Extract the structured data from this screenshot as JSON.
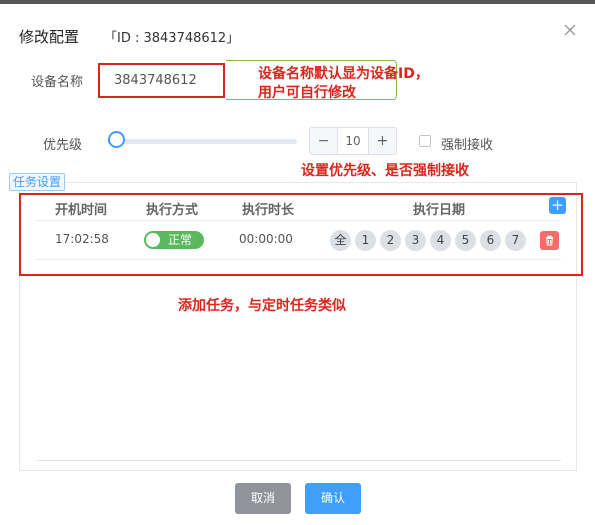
{
  "dialog": {
    "title": "修改配置",
    "id_text": "「ID : 3843748612」"
  },
  "form": {
    "device_name_label": "设备名称",
    "device_name_value": "3843748612",
    "priority_label": "优先级",
    "priority_value": "10",
    "priority_slider_fraction": 0.05,
    "force_label": "强制接收",
    "force_checked": false
  },
  "annotations": {
    "name_line1": "设备名称默认显为设备ID，",
    "name_line2": "用户可自行修改",
    "priority": "设置优先级、是否强制接收",
    "task": "添加任务，与定时任务类似"
  },
  "tasks": {
    "section_label": "任务设置",
    "headers": {
      "start_time": "开机时间",
      "mode": "执行方式",
      "duration": "执行时长",
      "dates": "执行日期"
    },
    "rows": [
      {
        "start_time": "17:02:58",
        "mode": "正常",
        "duration": "00:00:00",
        "days": [
          "全",
          "1",
          "2",
          "3",
          "4",
          "5",
          "6",
          "7"
        ]
      }
    ]
  },
  "buttons": {
    "cancel": "取消",
    "ok": "确认"
  },
  "colors": {
    "primary": "#409eff",
    "annotation": "#d9271e",
    "switch_on": "#5cb85c",
    "delete": "#f56c6c"
  }
}
